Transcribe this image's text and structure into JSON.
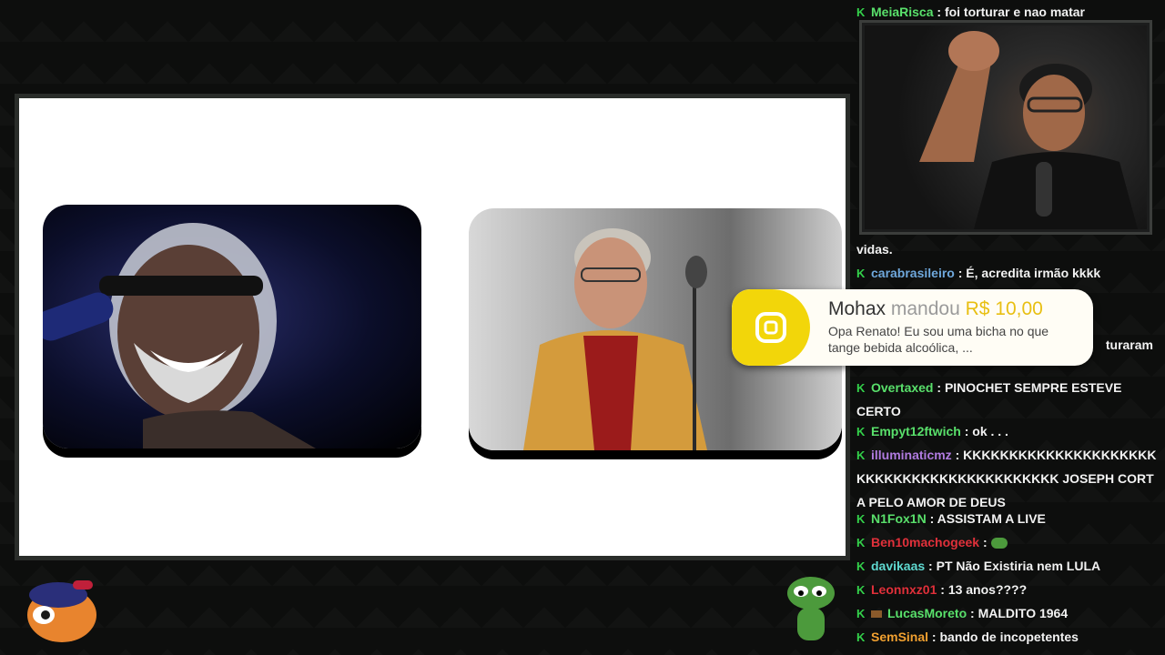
{
  "chat": {
    "messages": [
      {
        "user": "MeiaRisca",
        "color": "#59e06b",
        "text": "foi torturar e nao matar"
      },
      {
        "user": "",
        "color": "#f2f2f2",
        "text": "vidas."
      },
      {
        "user": "carabrasileiro",
        "color": "#6fa8dc",
        "text": "É, acredita irmão kkkk"
      },
      {
        "user": "",
        "color": "#f2f2f2",
        "text": "turaram"
      },
      {
        "user": "Overtaxed",
        "color": "#59e06b",
        "text": "PINOCHET SEMPRE ESTEVE CERTO"
      },
      {
        "user": "Empyt12ftwich",
        "color": "#59e06b",
        "text": "ok . . ."
      },
      {
        "user": "illuminaticmz",
        "color": "#b07be0",
        "text": "KKKKKKKKKKKKKKKKKKKKKKKKKKKKKKKKKKKKKKKKKKK JOSEPH CORTA PELO AMOR DE DEUS"
      },
      {
        "user": "N1Fox1N",
        "color": "#59e06b",
        "text": "ASSISTAM A LIVE"
      },
      {
        "user": "Ben10machogeek",
        "color": "#e0303a",
        "text": ""
      },
      {
        "user": "davikaas",
        "color": "#5fd9d0",
        "text": "PT Não Existiria nem LULA"
      },
      {
        "user": "Leonnxz01",
        "color": "#e0303a",
        "text": "13 anos????"
      },
      {
        "user": "LucasMoreto",
        "color": "#59e06b",
        "text": "MALDITO 1964"
      },
      {
        "user": "SemSinal",
        "color": "#f0a030",
        "text": "bando de incopetentes"
      }
    ]
  },
  "donation": {
    "name": "Mohax",
    "sent": "mandou",
    "amount": "R$ 10,00",
    "message": "Opa Renato! Eu sou uma bicha no que tange bebida alcoólica, ..."
  },
  "colors": {
    "accent": "#f2d60a",
    "badge": "#33d14a"
  }
}
